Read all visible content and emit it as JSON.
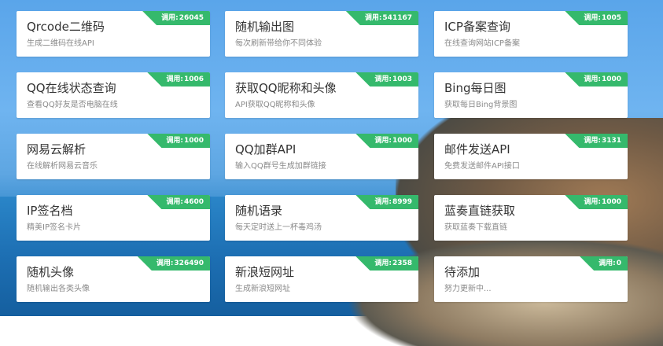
{
  "usage_label": "调用:",
  "cards": [
    {
      "title": "Qrcode二维码",
      "desc": "生成二维码在线API",
      "calls": "26045"
    },
    {
      "title": "随机输出图",
      "desc": "每次刷新带给你不同体验",
      "calls": "541167"
    },
    {
      "title": "ICP备案查询",
      "desc": "在线查询网站ICP备案",
      "calls": "1005"
    },
    {
      "title": "QQ在线状态查询",
      "desc": "查看QQ好友是否电脑在线",
      "calls": "1006"
    },
    {
      "title": "获取QQ昵称和头像",
      "desc": "API获取QQ昵称和头像",
      "calls": "1003"
    },
    {
      "title": "Bing每日图",
      "desc": "获取每日Bing背景图",
      "calls": "1000"
    },
    {
      "title": "网易云解析",
      "desc": "在线解析网易云音乐",
      "calls": "1000"
    },
    {
      "title": "QQ加群API",
      "desc": "输入QQ群号生成加群链接",
      "calls": "1000"
    },
    {
      "title": "邮件发送API",
      "desc": "免费发送邮件API接口",
      "calls": "3131"
    },
    {
      "title": "IP签名档",
      "desc": "精美IP签名卡片",
      "calls": "4600"
    },
    {
      "title": "随机语录",
      "desc": "每天定时送上一杯毒鸡汤",
      "calls": "8999"
    },
    {
      "title": "蓝奏直链获取",
      "desc": "获取蓝奏下载直链",
      "calls": "1000"
    },
    {
      "title": "随机头像",
      "desc": "随机输出各类头像",
      "calls": "326490"
    },
    {
      "title": "新浪短网址",
      "desc": "生成新浪短网址",
      "calls": "2358"
    },
    {
      "title": "待添加",
      "desc": "努力更新中...",
      "calls": "0"
    }
  ]
}
